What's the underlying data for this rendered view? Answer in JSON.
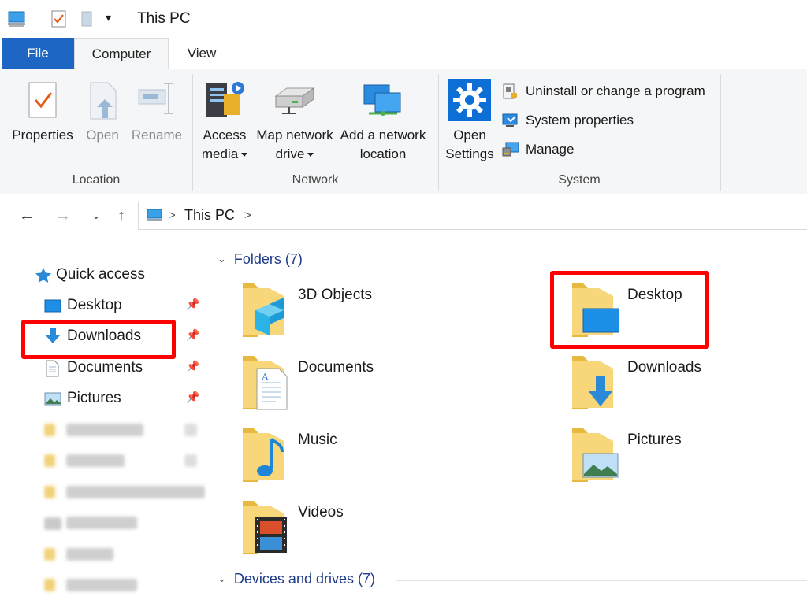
{
  "window": {
    "title": "This PC"
  },
  "tabs": {
    "file": "File",
    "computer": "Computer",
    "view": "View"
  },
  "ribbon": {
    "location": {
      "label": "Location",
      "properties": "Properties",
      "open": "Open",
      "rename": "Rename"
    },
    "network": {
      "label": "Network",
      "access_media_1": "Access",
      "access_media_2": "media",
      "map_drive_1": "Map network",
      "map_drive_2": "drive",
      "add_location_1": "Add a network",
      "add_location_2": "location"
    },
    "system": {
      "label": "System",
      "open_settings_1": "Open",
      "open_settings_2": "Settings",
      "uninstall": "Uninstall or change a program",
      "system_properties": "System properties",
      "manage": "Manage"
    }
  },
  "address": {
    "crumb": "This PC"
  },
  "navpane": {
    "quick_access": "Quick access",
    "items": [
      {
        "label": "Desktop",
        "icon": "desktop-icon"
      },
      {
        "label": "Downloads",
        "icon": "download-arrow-icon"
      },
      {
        "label": "Documents",
        "icon": "document-icon"
      },
      {
        "label": "Pictures",
        "icon": "pictures-icon"
      }
    ]
  },
  "content": {
    "folders_header": "Folders (7)",
    "devices_header": "Devices and drives (7)",
    "folders": [
      {
        "label": "3D Objects",
        "icon": "3d-objects-folder-icon"
      },
      {
        "label": "Desktop",
        "icon": "desktop-folder-icon"
      },
      {
        "label": "Documents",
        "icon": "documents-folder-icon"
      },
      {
        "label": "Downloads",
        "icon": "downloads-folder-icon"
      },
      {
        "label": "Music",
        "icon": "music-folder-icon"
      },
      {
        "label": "Pictures",
        "icon": "pictures-folder-icon"
      },
      {
        "label": "Videos",
        "icon": "videos-folder-icon"
      }
    ]
  },
  "colors": {
    "accent": "#1e66c3",
    "highlight": "#ff0000",
    "section_text": "#1e3a8a"
  }
}
